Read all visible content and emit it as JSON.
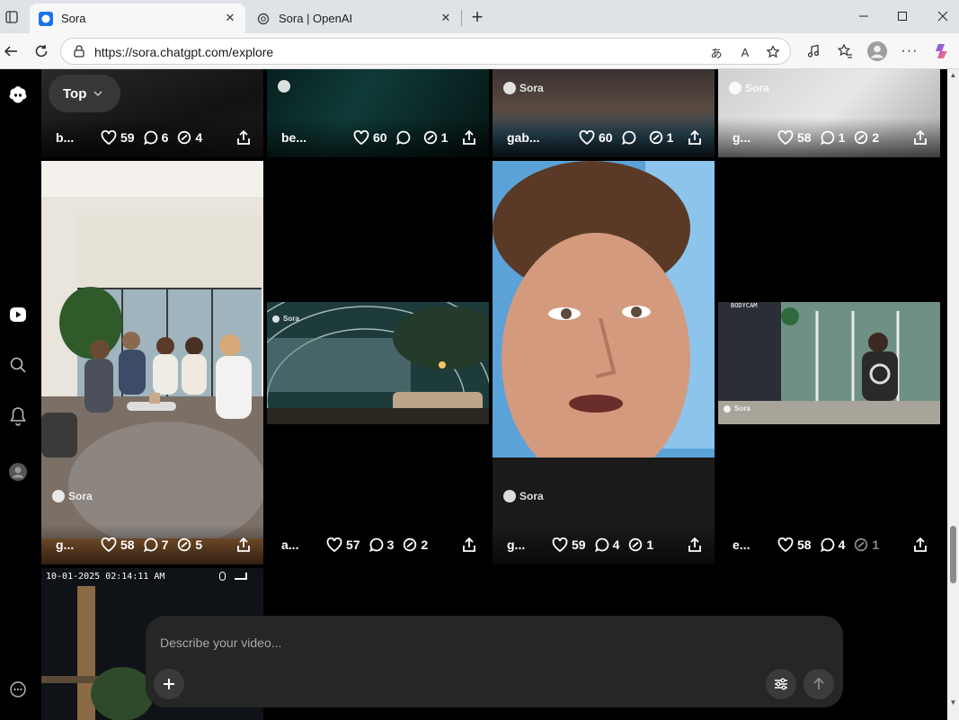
{
  "browser": {
    "tabs": [
      {
        "title": "Sora",
        "active": true
      },
      {
        "title": "Sora | OpenAI",
        "active": false
      }
    ],
    "url": "https://sora.chatgpt.com/explore",
    "new_tab": "+"
  },
  "page": {
    "sort_menu": {
      "label": "Top"
    },
    "watermark": "Sora",
    "bodycam_text": "BODYCAM",
    "cam_timestamp": "10-01-2025 02:14:11 AM",
    "composer": {
      "placeholder": "Describe your video..."
    },
    "tiles": [
      {
        "title": "b...",
        "likes": "59",
        "comments": "6",
        "remixes": "4"
      },
      {
        "title": "be...",
        "likes": "60",
        "comments": "",
        "remixes": "1"
      },
      {
        "title": "gab...",
        "likes": "60",
        "comments": "",
        "remixes": "1"
      },
      {
        "title": "g...",
        "likes": "58",
        "comments": "1",
        "remixes": "2"
      },
      {
        "title": "g...",
        "likes": "58",
        "comments": "7",
        "remixes": "5"
      },
      {
        "title": "a...",
        "likes": "57",
        "comments": "3",
        "remixes": "2"
      },
      {
        "title": "g...",
        "likes": "59",
        "comments": "4",
        "remixes": "1"
      },
      {
        "title": "e...",
        "likes": "58",
        "comments": "4",
        "remixes": "1"
      }
    ]
  },
  "colors": {
    "accent": "#1a73e8",
    "page_bg": "#000000",
    "composer_bg": "#262626"
  }
}
